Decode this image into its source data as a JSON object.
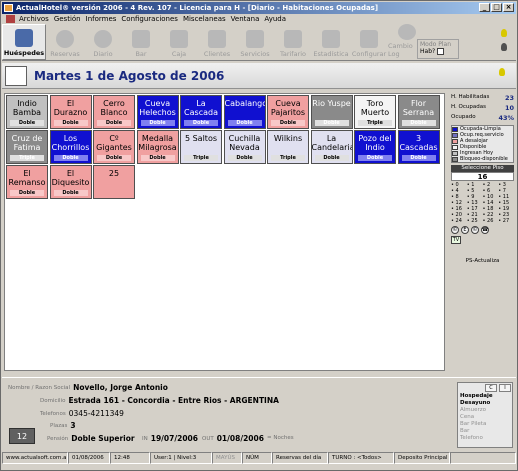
{
  "window": {
    "title": "ActualHotel® versión 2006 - 4 Rev. 107 - Licencia para H - [Diario - Habitaciones Ocupadas]"
  },
  "menu": [
    "Archivos",
    "Gestión",
    "Informes",
    "Configuraciones",
    "Miscelaneas",
    "Ventana",
    "Ayuda"
  ],
  "toolbar": {
    "items": [
      {
        "label": "Huéspedes",
        "icon": "guests-icon"
      },
      {
        "label": "Reservas",
        "icon": "reservations-icon"
      },
      {
        "label": "Diario",
        "icon": "daily-icon"
      },
      {
        "label": "Bar",
        "icon": "bar-icon"
      },
      {
        "label": "Caja",
        "icon": "cash-icon"
      },
      {
        "label": "Clientes",
        "icon": "clients-icon"
      },
      {
        "label": "Servicios",
        "icon": "services-icon"
      },
      {
        "label": "Tarifario",
        "icon": "rates-icon"
      },
      {
        "label": "Estadística",
        "icon": "stats-icon"
      },
      {
        "label": "Configurar",
        "icon": "config-icon"
      },
      {
        "label": "Cambio Log",
        "icon": "log-icon"
      }
    ],
    "modo": {
      "title": "Modo Plan",
      "hab_label": "Hab?"
    }
  },
  "date_title": "Martes 1 de Agosto de 2006",
  "rooms": [
    [
      {
        "name": "Indio Bamba",
        "type": "Doble",
        "color": "gray"
      },
      {
        "name": "El Durazno",
        "type": "Doble",
        "color": "pink"
      },
      {
        "name": "Cerro Blanco",
        "type": "Doble",
        "color": "pink"
      },
      {
        "name": "Cueva Helechos",
        "type": "Doble",
        "color": "blue"
      },
      {
        "name": "La Cascada",
        "type": "Doble",
        "color": "blue"
      },
      {
        "name": "Cabalango",
        "type": "Doble",
        "color": "blue"
      },
      {
        "name": "Cueva Pajaritos",
        "type": "Doble",
        "color": "pink"
      },
      {
        "name": "Rio Yuspe",
        "type": "Doble",
        "color": "dgray"
      },
      {
        "name": "Toro Muerto",
        "type": "Triple",
        "color": "white"
      },
      {
        "name": "Flor Serrana",
        "type": "Doble",
        "color": "dgray"
      }
    ],
    [
      {
        "name": "Cruz de Fatima",
        "type": "Triple",
        "color": "dgray"
      },
      {
        "name": "Los Chorrillos",
        "type": "Doble",
        "color": "blue"
      },
      {
        "name": "Cº Gigantes",
        "type": "Doble",
        "color": "pink"
      },
      {
        "name": "Medalla Milagrosa",
        "type": "Doble",
        "color": "pink"
      },
      {
        "name": "5 Saltos",
        "type": "Triple",
        "color": "light"
      },
      {
        "name": "Cuchilla Nevada",
        "type": "Doble",
        "color": "light"
      },
      {
        "name": "Wilkins",
        "type": "Triple",
        "color": "light"
      },
      {
        "name": "La Candelaria",
        "type": "Doble",
        "color": "light"
      },
      {
        "name": "Pozo del Indio",
        "type": "Doble",
        "color": "blue"
      },
      {
        "name": "3 Cascadas",
        "type": "Doble",
        "color": "blue"
      }
    ],
    [
      {
        "name": "El Remanso",
        "type": "Doble",
        "color": "pink"
      },
      {
        "name": "El Diquesito",
        "type": "Doble",
        "color": "pink"
      },
      {
        "name": "25",
        "type": "",
        "color": "pink"
      }
    ]
  ],
  "colors": {
    "gray": "#c0c0c0",
    "pink": "#f0a0a0",
    "blue": "#1010d0",
    "white": "#f4f4f4",
    "dgray": "#8a8a8a",
    "light": "#e0e0f0"
  },
  "stats": {
    "hab_label": "H. Habilitadas",
    "hab_val": "23",
    "ocu_label": "H. Ocupadas",
    "ocu_val": "10",
    "pct_label": "Ocupado",
    "pct_val": "43%"
  },
  "legend": [
    {
      "label": "Ocupada-Limpia",
      "color": "#1010d0"
    },
    {
      "label": "Ocup.req.servicio",
      "color": "#7070c0"
    },
    {
      "label": "A desalojar",
      "color": "#f0a0a0"
    },
    {
      "label": "Disponible",
      "color": "#f4f4f4"
    },
    {
      "label": "Ingresan Hoy",
      "color": "#c0c0c0"
    },
    {
      "label": "Bloqueo-disponible",
      "color": "#8a8a8a"
    }
  ],
  "piso": {
    "title": "Seleccione Piso",
    "value": "16"
  },
  "calendar": [
    "0",
    "1",
    "2",
    "3",
    "4",
    "5",
    "6",
    "7",
    "8",
    "9",
    "10",
    "11",
    "12",
    "13",
    "14",
    "15",
    "16",
    "17",
    "18",
    "19",
    "20",
    "21",
    "22",
    "23",
    "24",
    "25",
    "26",
    "27"
  ],
  "right_icons": [
    "©",
    "E",
    "©",
    "☎"
  ],
  "tv_label": "TV",
  "ps_label": "PS-Actualiza",
  "guest": {
    "name_label": "Nombre / Razon Social",
    "name": "Novello, Jorge Antonio",
    "dom_label": "Domicilio",
    "dom": "Estrada 161 - Concordia - Entre Rios - ARGENTINA",
    "tel_label": "Telefonos",
    "tel": "0345-4211349",
    "plazas_label": "Plazas",
    "plazas": "3",
    "pension_label": "Pensión",
    "pension": "Doble Superior",
    "in_label": "IN",
    "in_date": "19/07/2006",
    "out_label": "OUT",
    "out_date": "01/08/2006",
    "noches_label": "= Noches",
    "room_number": "12"
  },
  "side_panel": {
    "btn1": "C",
    "btn2": "I",
    "lines": [
      {
        "text": "Hospedaje",
        "bold": true
      },
      {
        "text": "Desayuno",
        "bold": true
      },
      {
        "text": "Almuerzo",
        "bold": false
      },
      {
        "text": "Cena",
        "bold": false
      },
      {
        "text": "Bar Pileta",
        "bold": false
      },
      {
        "text": "Bar",
        "bold": false
      },
      {
        "text": "Telefono",
        "bold": false
      }
    ]
  },
  "statusbar": {
    "web": "www.actualsoft.com.ar",
    "date": "01/08/2006",
    "time": "12:48",
    "user": "User:1 | Nivel:3",
    "mayus": "MAYÚS",
    "num": "NÚM",
    "res": "Reservas del día",
    "turno": "TURNO : <Todos>",
    "deposito": "Deposito Principal"
  }
}
